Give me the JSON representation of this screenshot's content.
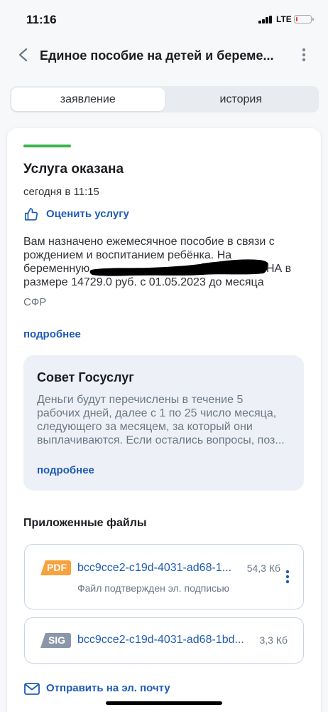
{
  "status_bar": {
    "time": "11:16",
    "network": "LTE",
    "signal_bars": 4,
    "battery_level": 0.12
  },
  "header": {
    "title": "Единое пособие на детей и береме...",
    "back_icon": "chevron-left-icon",
    "menu_icon": "more-vertical-icon"
  },
  "tabs": [
    {
      "label": "заявление",
      "selected": true
    },
    {
      "label": "история",
      "selected": false
    }
  ],
  "status_card": {
    "status_title": "Услуга оказана",
    "timestamp": "сегодня в 11:15",
    "rate_icon": "thumbs-up-icon",
    "rate_link": "Оценить услугу",
    "message_lines": [
      {
        "text": "Вам назначено ежемесячное пособие в связи с"
      },
      {
        "text": "рождением и воспитанием ребёнка. На"
      },
      {
        "text": "беременную",
        "text_after_redaction": "НА в"
      },
      {
        "text": "размере 14729.0 руб. с 01.05.2023 до месяца"
      }
    ],
    "source": "СФР",
    "details_link": "подробнее"
  },
  "tip": {
    "title": "Совет Госуслуг",
    "text_lines": [
      "Деньги будут перечислены в течение 5",
      "рабочих дней, далее с 1 по 25 число месяца,",
      "следующего за месяцем, за который они",
      "выплачиваются. Если остались вопросы, поз..."
    ],
    "details_link": "подробнее"
  },
  "attachments": {
    "title": "Приложенные файлы",
    "files": [
      {
        "type": "PDF",
        "name": "bcc9cce2-c19d-4031-ad68-1...",
        "size": "54,3 Кб",
        "note": "Файл подтвержден эл. подписью",
        "menu_icon": "more-vertical-icon"
      },
      {
        "type": "SIG",
        "name": "bcc9cce2-c19d-4031-ad68-1bd...",
        "size": "3,3 Кб"
      }
    ]
  },
  "send_email": {
    "icon": "envelope-icon",
    "label": "Отправить на эл. почту"
  },
  "colors": {
    "accent": "#1f5bb4",
    "success": "#3bb54a",
    "pdf_badge": "#f7a23b",
    "sig_badge": "#8b97a8",
    "battery_low": "#e5383b"
  }
}
